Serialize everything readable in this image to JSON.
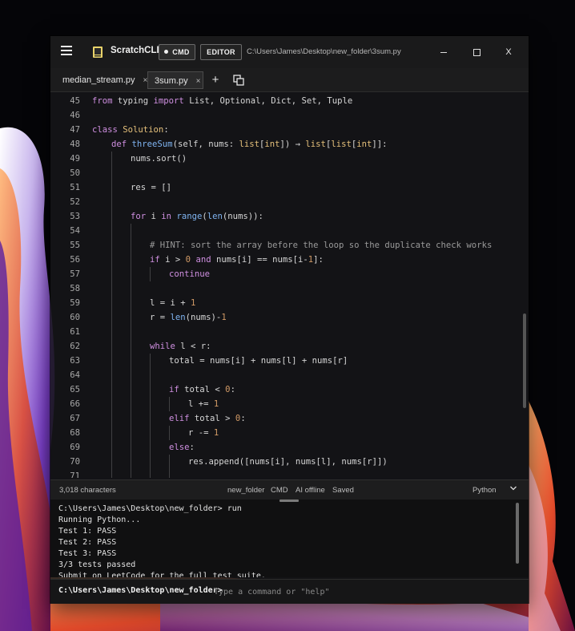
{
  "titlebar": {
    "app_name": "ScratchCLI",
    "cmd_label": "CMD",
    "editor_label": "EDITOR",
    "path": "C:\\Users\\James\\Desktop\\new_folder\\3sum.py",
    "close_label": "X"
  },
  "tabs": [
    {
      "label": "median_stream.py",
      "close": "×"
    },
    {
      "label": "3sum.py",
      "close": "×"
    }
  ],
  "tab_add": "+",
  "code_lines": [
    {
      "n": "45",
      "indent": 0,
      "tokens": [
        [
          "from",
          "kw"
        ],
        [
          " typing ",
          ""
        ],
        [
          "import",
          "kw"
        ],
        [
          " List, Optional, Dict, Set, Tuple",
          ""
        ]
      ]
    },
    {
      "n": "46",
      "indent": 0,
      "tokens": []
    },
    {
      "n": "47",
      "indent": 0,
      "tokens": [
        [
          "class",
          "kw"
        ],
        [
          " ",
          ""
        ],
        [
          "Solution",
          "ty"
        ],
        [
          ":",
          ""
        ]
      ]
    },
    {
      "n": "48",
      "indent": 1,
      "tokens": [
        [
          "def",
          "kw"
        ],
        [
          " ",
          ""
        ],
        [
          "threeSum",
          "fn"
        ],
        [
          "(self, nums: ",
          ""
        ],
        [
          "list",
          "ty"
        ],
        [
          "[",
          ""
        ],
        [
          "int",
          "ty"
        ],
        [
          "]) → ",
          ""
        ],
        [
          "list",
          "ty"
        ],
        [
          "[",
          ""
        ],
        [
          "list",
          "ty"
        ],
        [
          "[",
          ""
        ],
        [
          "int",
          "ty"
        ],
        [
          "]]:",
          ""
        ]
      ]
    },
    {
      "n": "49",
      "indent": 2,
      "tokens": [
        [
          "nums.sort()",
          ""
        ]
      ]
    },
    {
      "n": "50",
      "indent": 1,
      "guides": 1,
      "tokens": []
    },
    {
      "n": "51",
      "indent": 2,
      "tokens": [
        [
          "res = []",
          ""
        ]
      ]
    },
    {
      "n": "52",
      "indent": 1,
      "guides": 1,
      "tokens": []
    },
    {
      "n": "53",
      "indent": 2,
      "tokens": [
        [
          "for",
          "kw"
        ],
        [
          " i ",
          ""
        ],
        [
          "in",
          "kw"
        ],
        [
          " ",
          ""
        ],
        [
          "range",
          "fn"
        ],
        [
          "(",
          ""
        ],
        [
          "len",
          "fn"
        ],
        [
          "(nums)):",
          ""
        ]
      ]
    },
    {
      "n": "54",
      "indent": 2,
      "guides": 2,
      "tokens": []
    },
    {
      "n": "55",
      "indent": 3,
      "tokens": [
        [
          "# HINT: sort the array before the loop so the duplicate check works",
          "cm"
        ]
      ]
    },
    {
      "n": "56",
      "indent": 3,
      "tokens": [
        [
          "if",
          "kw"
        ],
        [
          " i > ",
          ""
        ],
        [
          "0",
          "nu"
        ],
        [
          " ",
          ""
        ],
        [
          "and",
          "kw"
        ],
        [
          " nums[i] == nums[i-",
          ""
        ],
        [
          "1",
          "nu"
        ],
        [
          "]:",
          ""
        ]
      ]
    },
    {
      "n": "57",
      "indent": 4,
      "tokens": [
        [
          "continue",
          "kw"
        ]
      ]
    },
    {
      "n": "58",
      "indent": 2,
      "guides": 2,
      "tokens": []
    },
    {
      "n": "59",
      "indent": 3,
      "tokens": [
        [
          "l = i + ",
          ""
        ],
        [
          "1",
          "nu"
        ]
      ]
    },
    {
      "n": "60",
      "indent": 3,
      "tokens": [
        [
          "r = ",
          ""
        ],
        [
          "len",
          "fn"
        ],
        [
          "(nums)-",
          ""
        ],
        [
          "1",
          "nu"
        ]
      ]
    },
    {
      "n": "61",
      "indent": 2,
      "guides": 2,
      "tokens": []
    },
    {
      "n": "62",
      "indent": 3,
      "tokens": [
        [
          "while",
          "kw"
        ],
        [
          " l < r:",
          ""
        ]
      ]
    },
    {
      "n": "63",
      "indent": 4,
      "tokens": [
        [
          "total = nums[i] + nums[l] + nums[r]",
          ""
        ]
      ]
    },
    {
      "n": "64",
      "indent": 3,
      "guides": 3,
      "tokens": []
    },
    {
      "n": "65",
      "indent": 4,
      "tokens": [
        [
          "if",
          "kw"
        ],
        [
          " total < ",
          ""
        ],
        [
          "0",
          "nu"
        ],
        [
          ":",
          ""
        ]
      ]
    },
    {
      "n": "66",
      "indent": 5,
      "tokens": [
        [
          "l += ",
          ""
        ],
        [
          "1",
          "nu"
        ]
      ]
    },
    {
      "n": "67",
      "indent": 4,
      "tokens": [
        [
          "elif",
          "kw"
        ],
        [
          " total > ",
          ""
        ],
        [
          "0",
          "nu"
        ],
        [
          ":",
          ""
        ]
      ]
    },
    {
      "n": "68",
      "indent": 5,
      "tokens": [
        [
          "r -= ",
          ""
        ],
        [
          "1",
          "nu"
        ]
      ]
    },
    {
      "n": "69",
      "indent": 4,
      "tokens": [
        [
          "else",
          "kw"
        ],
        [
          ":",
          ""
        ]
      ]
    },
    {
      "n": "70",
      "indent": 5,
      "tokens": [
        [
          "res.append([nums[i], nums[l], nums[r]])",
          ""
        ]
      ]
    },
    {
      "n": "71",
      "indent": 4,
      "guides": 4,
      "tokens": []
    }
  ],
  "statusbar": {
    "chars": "3,018 characters",
    "folder": "new_folder",
    "mode": "CMD",
    "ai": "AI offline",
    "saved": "Saved",
    "language": "Python"
  },
  "terminal": {
    "lines": [
      "C:\\Users\\James\\Desktop\\new_folder> run",
      "Running Python...",
      "Test 1: PASS",
      "Test 2: PASS",
      "Test 3: PASS",
      "3/3 tests passed",
      "Submit on LeetCode for the full test suite."
    ],
    "prompt": "C:\\Users\\James\\Desktop\\new_folder>",
    "placeholder": "Type a command or \"help\""
  }
}
